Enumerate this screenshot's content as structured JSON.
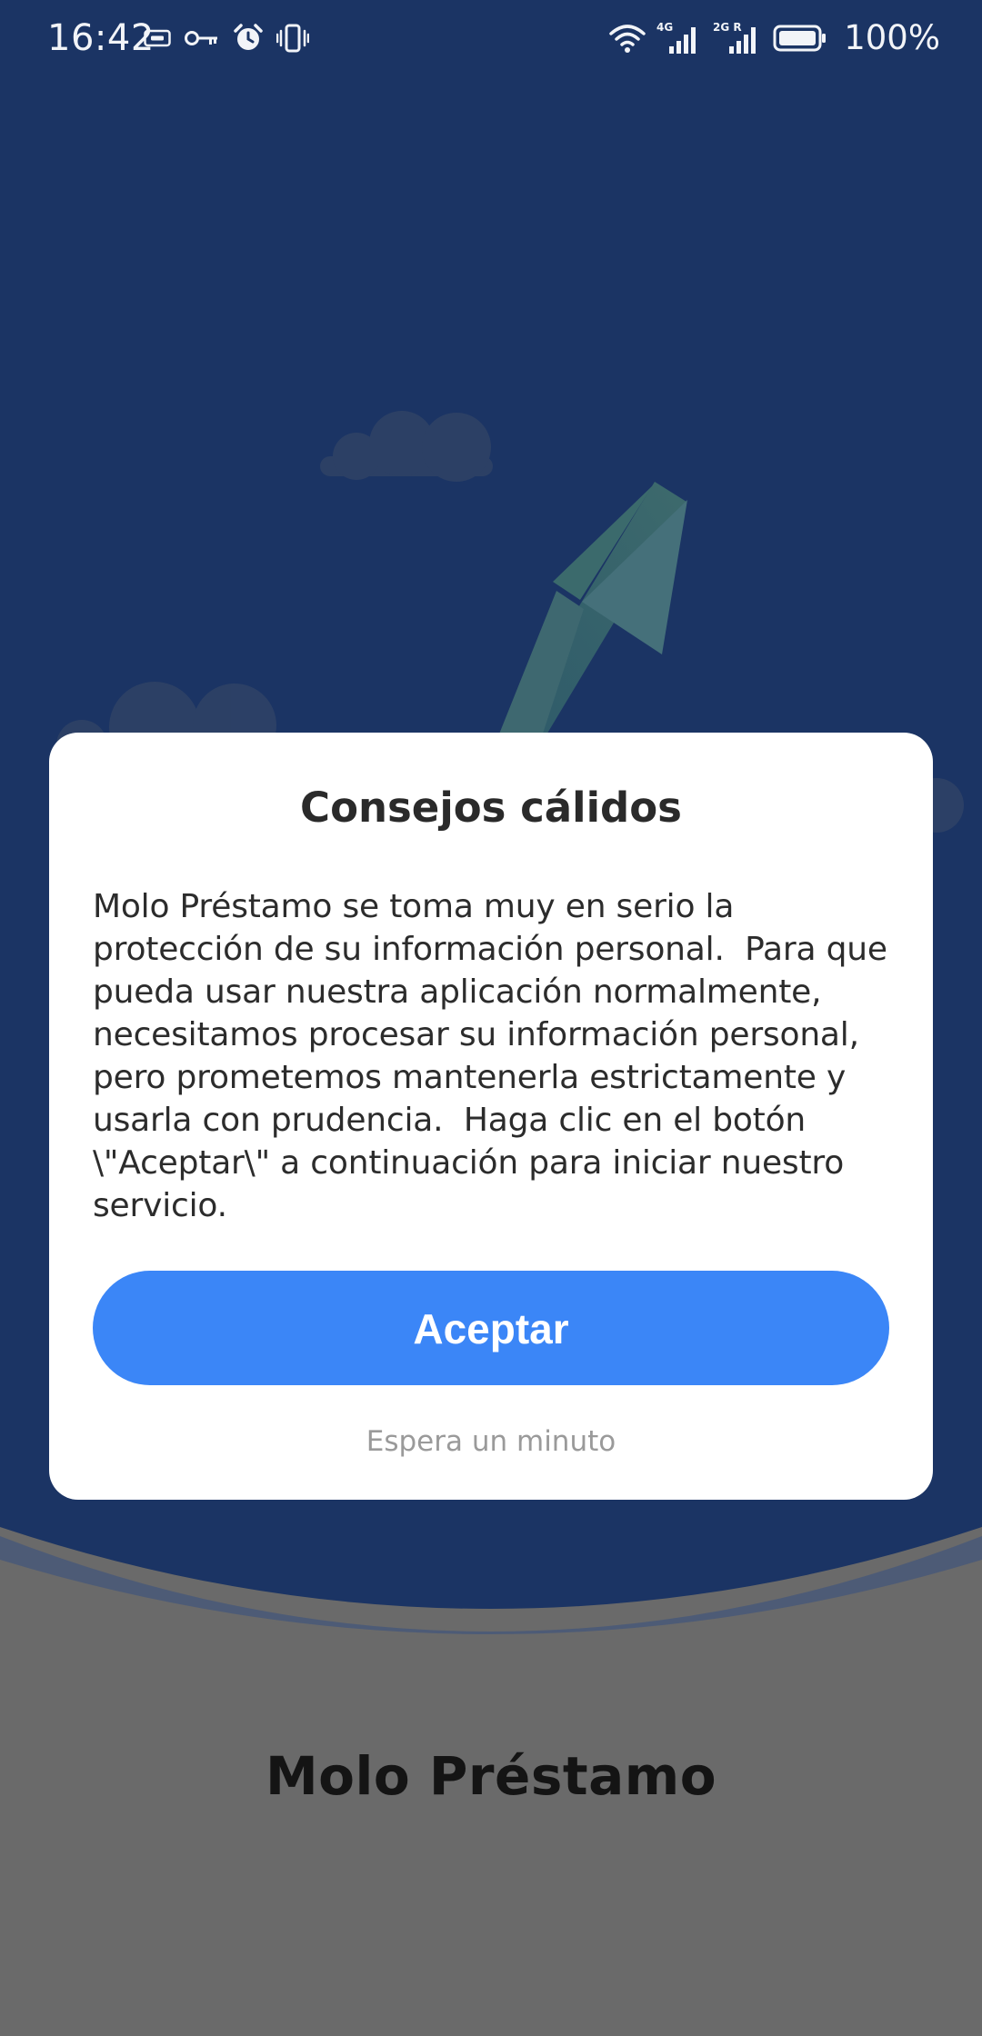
{
  "status_bar": {
    "time": "16:42",
    "left_icons": [
      "screen-record-icon",
      "vpn-key-icon",
      "alarm-icon",
      "vibrate-icon"
    ],
    "right_icons": [
      "wifi-icon",
      "signal-4g-icon",
      "signal-2g-icon",
      "battery-icon"
    ],
    "network_1": "4G",
    "network_2": "2G R",
    "battery": "100%"
  },
  "background": {
    "hero_color": "#1b3464",
    "footer_color": "#6a6a6a"
  },
  "app": {
    "name": "Molo Préstamo"
  },
  "dialog": {
    "title": "Consejos cálidos",
    "body": "Molo Préstamo se toma muy en serio la protección de su información personal.  Para que pueda usar nuestra aplicación normalmente, necesitamos procesar su información personal, pero prometemos mantenerla estrictamente y usarla con prudencia.  Haga clic en el botón \\\"Aceptar\\\" a continuación para iniciar nuestro servicio.",
    "accept_label": "Aceptar",
    "wait_label": "Espera un minuto",
    "accent_color": "#3b86f7"
  }
}
